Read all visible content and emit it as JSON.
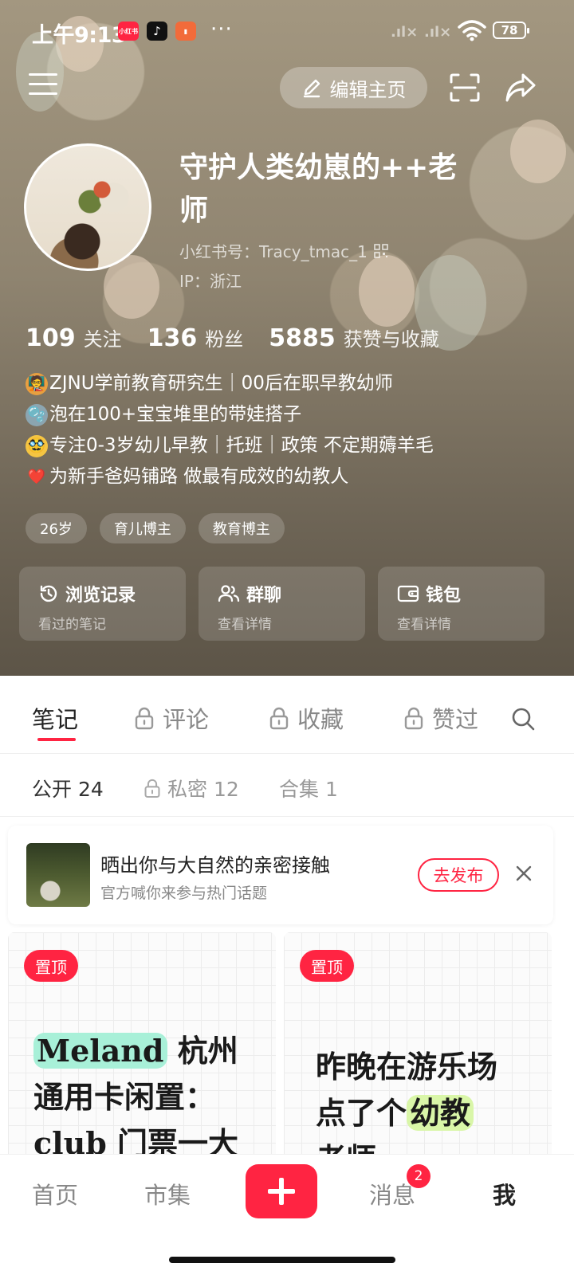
{
  "status_bar": {
    "time": "上午9:13",
    "apps": [
      "小红书",
      "抖音",
      "app"
    ],
    "more": "···",
    "battery": "78"
  },
  "toolbar": {
    "edit_label": "编辑主页"
  },
  "profile": {
    "nickname": "守护人类幼崽的++老师",
    "red_id": "小红书号：Tracy_tmac_1",
    "ip": "IP：浙江",
    "stats": [
      {
        "num": "109",
        "label": "关注"
      },
      {
        "num": "136",
        "label": "粉丝"
      },
      {
        "num": "5885",
        "label": "获赞与收藏"
      }
    ],
    "bio": [
      {
        "emoji": "🧑‍🏫",
        "text": "ZJNU学前教育研究生｜00后在职早教幼师"
      },
      {
        "emoji": "🫧",
        "text": "泡在100+宝宝堆里的带娃搭子"
      },
      {
        "emoji": "🥸",
        "text": "专注0-3岁幼儿早教｜托班｜政策 不定期薅羊毛"
      },
      {
        "emoji": "❤️",
        "text": "为新手爸妈铺路 做最有成效的幼教人"
      }
    ],
    "tags": [
      "26岁",
      "育儿博主",
      "教育博主"
    ],
    "cards": [
      {
        "title": "浏览记录",
        "sub": "看过的笔记"
      },
      {
        "title": "群聊",
        "sub": "查看详情"
      },
      {
        "title": "钱包",
        "sub": "查看详情"
      }
    ]
  },
  "tabs": [
    "笔记",
    "评论",
    "收藏",
    "赞过"
  ],
  "subtabs": [
    "公开 24",
    "私密 12",
    "合集 1"
  ],
  "promo": {
    "title": "晒出你与大自然的亲密接触",
    "subtitle": "官方喊你来参与热门话题",
    "button": "去发布"
  },
  "notes": [
    {
      "pin": "置顶",
      "hl": "Meland",
      "rest": "杭州",
      "line2": "通用卡闲置：",
      "line3": "club 门票一大"
    },
    {
      "pin": "置顶",
      "line1": "昨晚在游乐场",
      "line2_a": "点了个",
      "hl": "幼教",
      "line3": "老师"
    }
  ],
  "colors": {
    "accent": "#ff2442",
    "highlight_green": "#a8f0d8",
    "highlight_lime": "#d9f6a8"
  },
  "bottom_nav": {
    "items": [
      "首页",
      "市集",
      "消息",
      "我"
    ],
    "badge": "2"
  }
}
